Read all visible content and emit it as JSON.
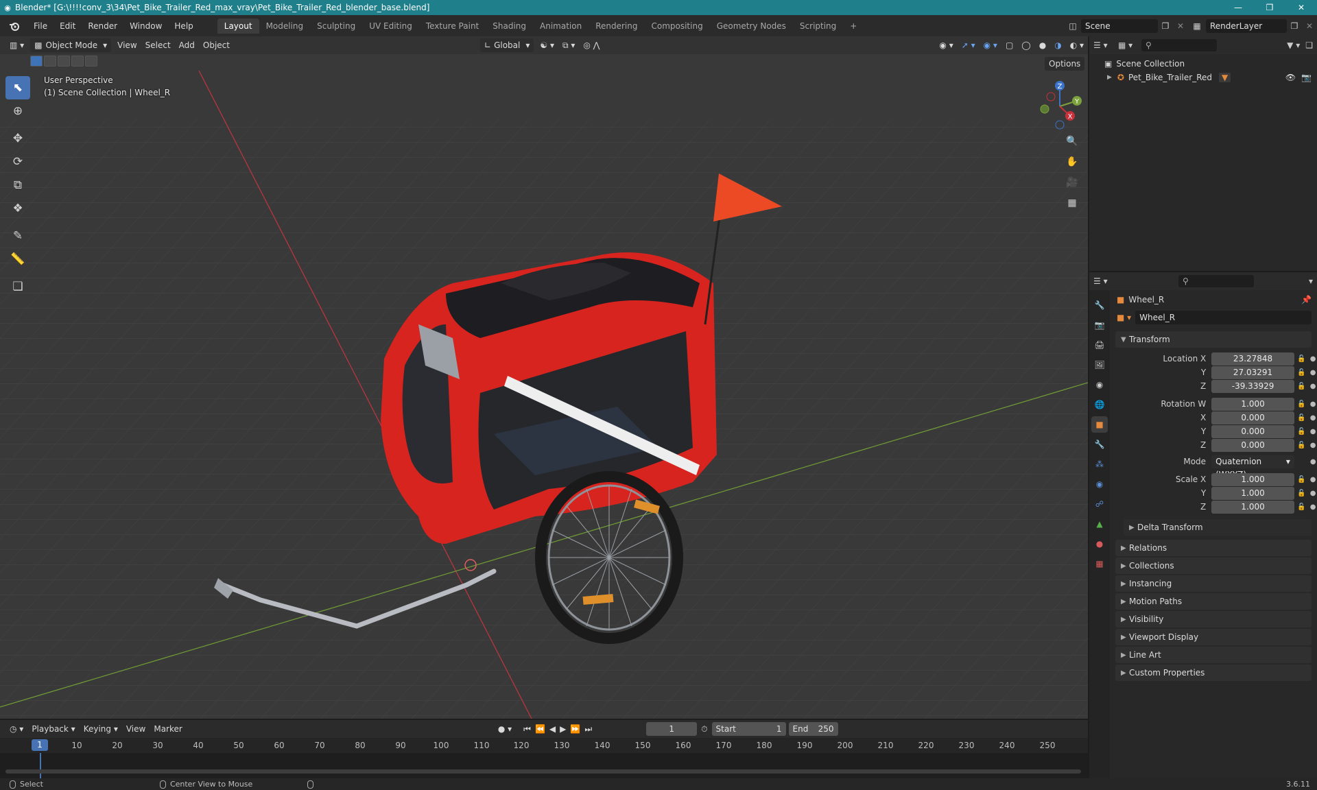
{
  "titlebar": {
    "title": "Blender* [G:\\!!!!conv_3\\34\\Pet_Bike_Trailer_Red_max_vray\\Pet_Bike_Trailer_Red_blender_base.blend]",
    "minimize": "—",
    "maximize": "❒",
    "close": "✕"
  },
  "menu": [
    "File",
    "Edit",
    "Render",
    "Window",
    "Help"
  ],
  "workspaces": [
    {
      "label": "Layout",
      "active": true
    },
    {
      "label": "Modeling",
      "active": false
    },
    {
      "label": "Sculpting",
      "active": false
    },
    {
      "label": "UV Editing",
      "active": false
    },
    {
      "label": "Texture Paint",
      "active": false
    },
    {
      "label": "Shading",
      "active": false
    },
    {
      "label": "Animation",
      "active": false
    },
    {
      "label": "Rendering",
      "active": false
    },
    {
      "label": "Compositing",
      "active": false
    },
    {
      "label": "Geometry Nodes",
      "active": false
    },
    {
      "label": "Scripting",
      "active": false
    }
  ],
  "add_workspace": "+",
  "scene": {
    "name": "Scene",
    "view_layer": "RenderLayer"
  },
  "viewport": {
    "mode": "Object Mode",
    "menus": [
      "View",
      "Select",
      "Add",
      "Object"
    ],
    "orientation": "Global",
    "options": "Options",
    "info_line1": "User Perspective",
    "info_line2": "(1) Scene Collection | Wheel_R"
  },
  "gizmo": {
    "x": "X",
    "y": "Y",
    "z": "Z"
  },
  "outliner": {
    "root": "Scene Collection",
    "item": "Pet_Bike_Trailer_Red"
  },
  "properties": {
    "object_name": "Wheel_R",
    "object_data_name": "Wheel_R",
    "transform_title": "Transform",
    "location_label": "Location X",
    "location": [
      "23.27848",
      "27.03291",
      "-39.33929"
    ],
    "rotation_label": "Rotation W",
    "rotation": [
      "1.000",
      "0.000",
      "0.000",
      "0.000"
    ],
    "mode_label": "Mode",
    "mode_value": "Quaternion (WXYZ)",
    "scale_label": "Scale X",
    "scale": [
      "1.000",
      "1.000",
      "1.000"
    ],
    "axis_y": "Y",
    "axis_z": "Z",
    "axis_x": "X",
    "delta_transform": "Delta Transform",
    "panels": [
      "Relations",
      "Collections",
      "Instancing",
      "Motion Paths",
      "Visibility",
      "Viewport Display",
      "Line Art",
      "Custom Properties"
    ]
  },
  "timeline": {
    "menus": [
      "Playback",
      "Keying",
      "View",
      "Marker"
    ],
    "current_frame": "1",
    "start_label": "Start",
    "start": "1",
    "end_label": "End",
    "end": "250",
    "ruler": [
      "1",
      "10",
      "20",
      "30",
      "40",
      "50",
      "60",
      "70",
      "80",
      "90",
      "100",
      "110",
      "120",
      "130",
      "140",
      "150",
      "160",
      "170",
      "180",
      "190",
      "200",
      "210",
      "220",
      "230",
      "240",
      "250"
    ]
  },
  "status": {
    "select": "Select",
    "center": "Center View to Mouse",
    "version": "3.6.11"
  },
  "colors": {
    "title_bar": "#1f7f8a",
    "accent": "#4772b3",
    "trailer_red": "#d8241f",
    "axis_x": "#c8303c",
    "axis_y": "#7ca23b",
    "axis_z": "#3b73c9"
  }
}
